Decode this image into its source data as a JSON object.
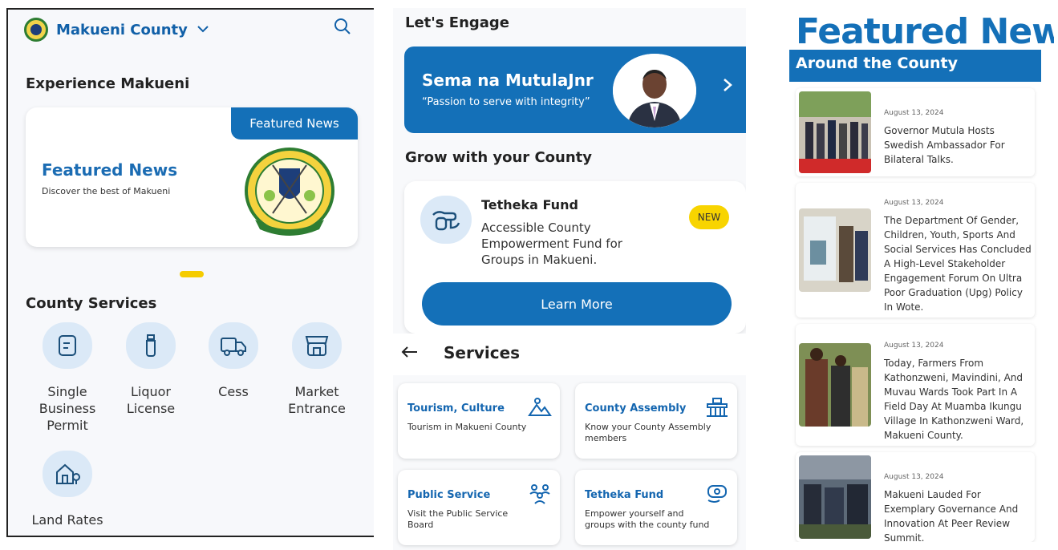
{
  "panel1": {
    "county_name": "Makueni County",
    "experience_title": "Experience Makueni",
    "hero": {
      "tab_label": "Featured News",
      "title": "Featured News",
      "subtitle": "Discover the best of Makueni"
    },
    "services_title": "County Services",
    "services": [
      {
        "label": "Single Business Permit",
        "icon": "document-icon"
      },
      {
        "label": "Liquor License",
        "icon": "bottle-icon"
      },
      {
        "label": "Cess",
        "icon": "truck-icon"
      },
      {
        "label": "Market Entrance",
        "icon": "market-stall-icon"
      },
      {
        "label": "Land Rates",
        "icon": "house-pin-icon"
      }
    ]
  },
  "panel2": {
    "engage_title": "Let's Engage",
    "banner": {
      "title": "Sema na MutulaJnr",
      "subtitle": "“Passion to serve with integrity”"
    },
    "grow_title": "Grow with your County",
    "fund": {
      "title": "Tetheka Fund",
      "description": "Accessible County Empowerment Fund for Groups in Makueni.",
      "badge": "NEW",
      "cta": "Learn More"
    },
    "services_header": "Services",
    "service_cards": [
      {
        "title": "Tourism, Culture",
        "desc": "Tourism in Makueni County",
        "icon": "mountains-icon"
      },
      {
        "title": "County Assembly",
        "desc": "Know your County Assembly members",
        "icon": "parliament-icon"
      },
      {
        "title": "Public Service",
        "desc": "Visit the Public Service Board",
        "icon": "people-group-icon"
      },
      {
        "title": "Tetheka Fund",
        "desc": "Empower yourself and groups with the county fund",
        "icon": "money-hand-icon"
      }
    ]
  },
  "panel3": {
    "title": "Featured News",
    "subtitle": "Around the County",
    "articles": [
      {
        "date": "August 13, 2024",
        "headline": "Governor Mutula Hosts Swedish Ambassador For Bilateral Talks."
      },
      {
        "date": "August 13, 2024",
        "headline": "The Department Of Gender, Children, Youth, Sports And Social Services Has Concluded A High-Level Stakeholder Engagement Forum On Ultra Poor Graduation (Upg) Policy In Wote."
      },
      {
        "date": "August 13, 2024",
        "headline": "Today, Farmers From Kathonzweni, Mavindini, And Muvau Wards Took Part In A Field Day At Muamba Ikungu Village In Kathonzweni Ward, Makueni County."
      },
      {
        "date": "August 13, 2024",
        "headline": "Makueni Lauded For Exemplary Governance And Innovation At Peer Review Summit."
      }
    ]
  },
  "colors": {
    "primary": "#1470b8",
    "accent": "#f8d400",
    "icon_bg": "#dbe9f7"
  }
}
